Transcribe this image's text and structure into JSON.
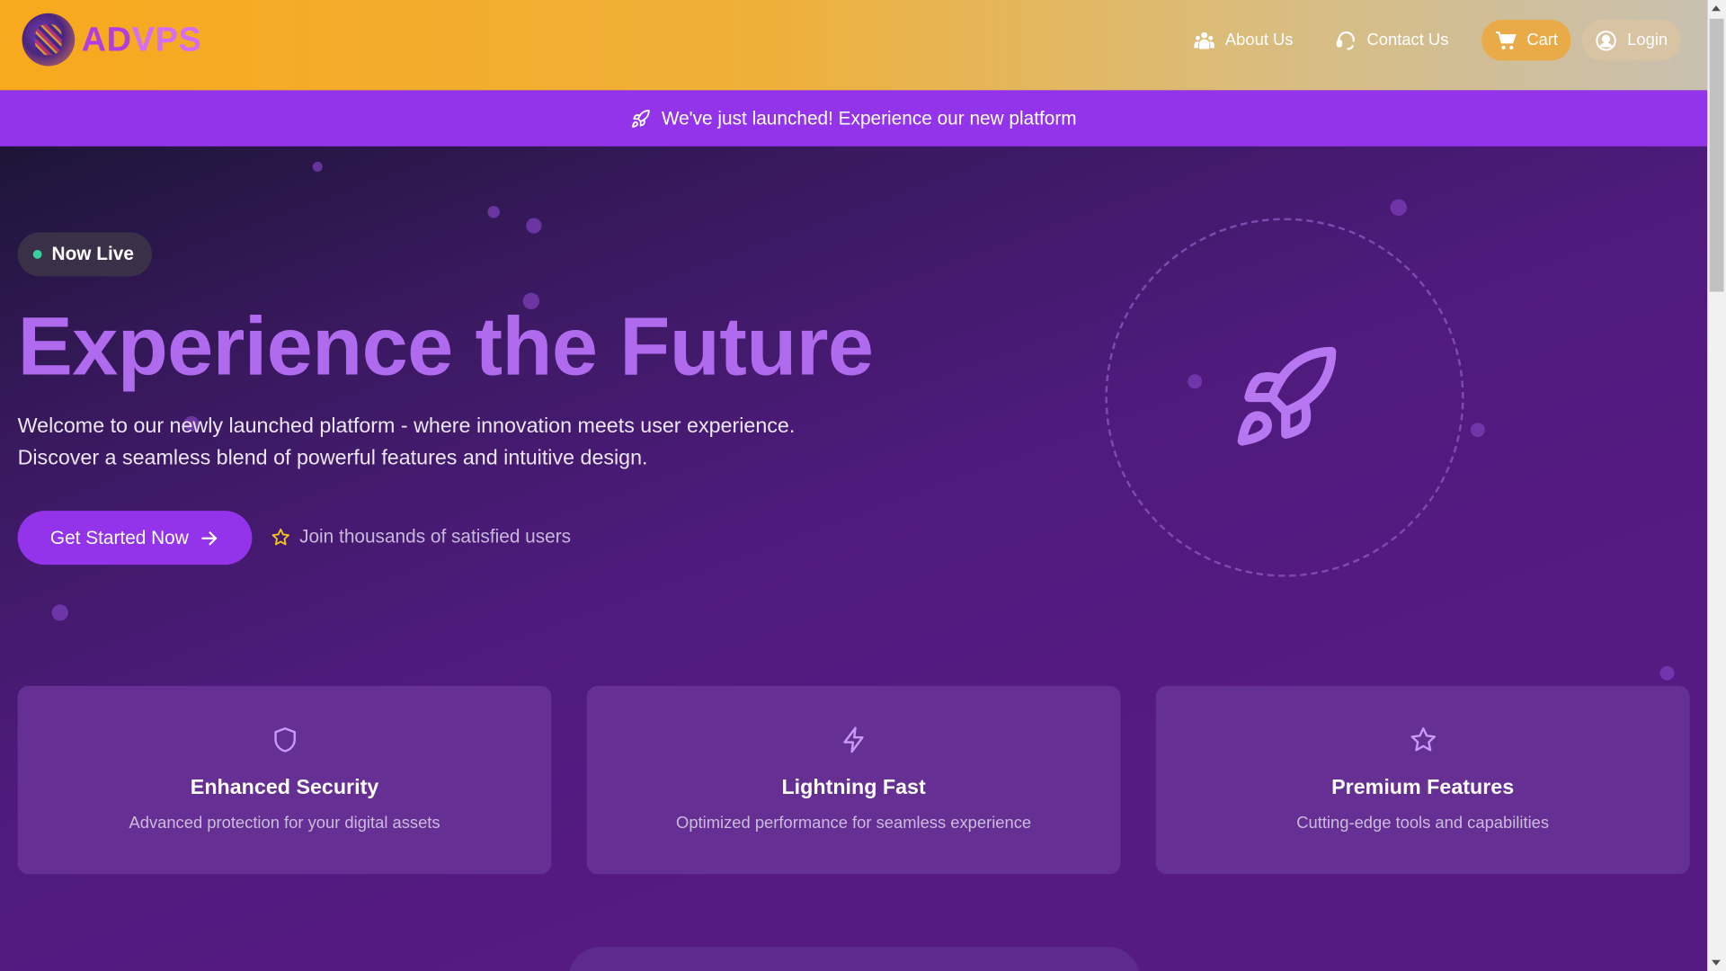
{
  "header": {
    "logo_text_1": "AD",
    "logo_text_2": "VPS",
    "nav": {
      "about": "About Us",
      "contact": "Contact Us",
      "cart": "Cart",
      "login": "Login"
    }
  },
  "announcement": {
    "text": "We've just launched! Experience our new platform",
    "icon": "rocket-icon"
  },
  "hero": {
    "badge": "Now Live",
    "headline": "Experience the Future",
    "description_line1": "Welcome to our newly launched platform - where innovation meets user experience.",
    "description_line2": "Discover a seamless blend of powerful features and intuitive design.",
    "cta_label": "Get Started Now",
    "social_proof": "Join thousands of satisfied users"
  },
  "features": [
    {
      "icon": "shield-icon",
      "title": "Enhanced Security",
      "subtitle": "Advanced protection for your digital assets"
    },
    {
      "icon": "lightning-icon",
      "title": "Lightning Fast",
      "subtitle": "Optimized performance for seamless experience"
    },
    {
      "icon": "star-icon",
      "title": "Premium Features",
      "subtitle": "Cutting-edge tools and capabilities"
    }
  ],
  "colors": {
    "accent": "#9333ea",
    "headline": "#b06aee",
    "header_gradient_start": "#f8a91d",
    "background": "#561a83",
    "live_dot": "#34d399"
  }
}
